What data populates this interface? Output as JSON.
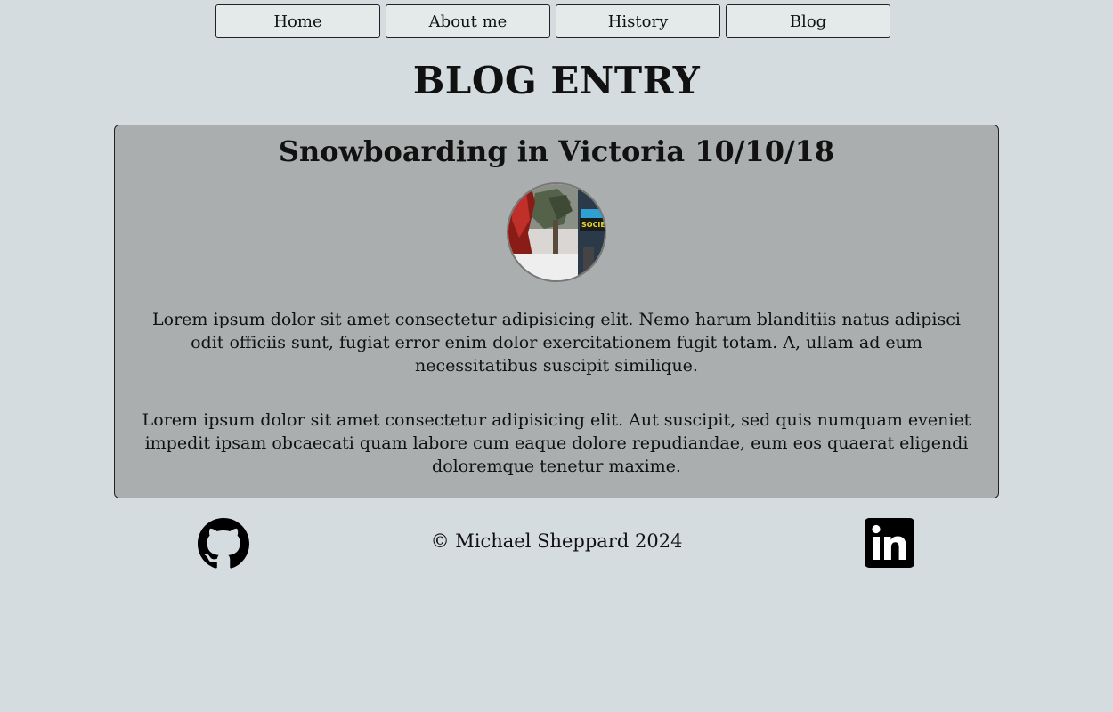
{
  "nav": {
    "items": [
      {
        "label": "Home"
      },
      {
        "label": "About me"
      },
      {
        "label": "History"
      },
      {
        "label": "Blog"
      }
    ]
  },
  "page": {
    "title": "BLOG ENTRY"
  },
  "post": {
    "title": "Snowboarding in Victoria 10/10/18",
    "image_icon": "snowboarding-photo",
    "image_text": "SOCIETY",
    "paragraphs": [
      "Lorem ipsum dolor sit amet consectetur adipisicing elit. Nemo harum blanditiis natus adipisci odit officiis sunt, fugiat error enim dolor exercitationem fugit totam. A, ullam ad eum necessitatibus suscipit similique.",
      "Lorem ipsum dolor sit amet consectetur adipisicing elit. Aut suscipit, sed quis numquam eveniet impedit ipsam obcaecati quam labore cum eaque dolore repudiandae, eum eos quaerat eligendi doloremque tenetur maxime."
    ]
  },
  "footer": {
    "copyright": "© Michael Sheppard 2024",
    "github_icon": "github-icon",
    "linkedin_icon": "linkedin-icon"
  },
  "colors": {
    "background": "#d4dcdf",
    "nav_button": "#e3eae9",
    "card": "#aaaeae"
  }
}
